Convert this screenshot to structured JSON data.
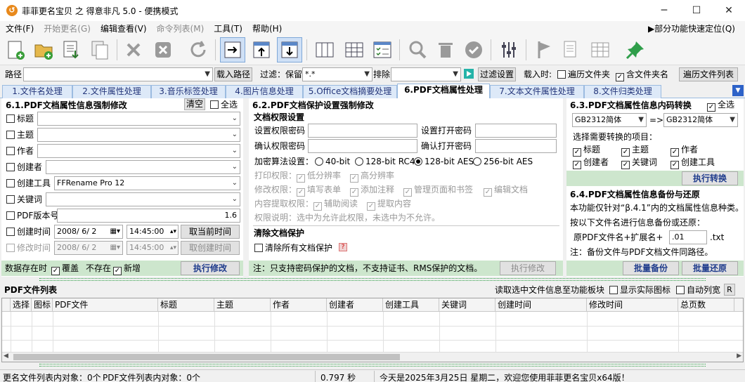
{
  "window": {
    "title": "菲菲更名宝贝 之 得意非凡 5.0 - 便携模式",
    "icon_glyph": "↺",
    "minimize": "─",
    "maximize": "☐",
    "close": "✕"
  },
  "menu": {
    "items": [
      "文件(F)",
      "开始更名(G)",
      "编辑查看(V)",
      "命令列表(M)",
      "工具(T)",
      "帮助(H)"
    ],
    "quick": "▶部分功能快速定位(Q)"
  },
  "toolbar": {
    "icons": [
      "new-file-icon",
      "open-folder-icon",
      "import-icon",
      "copy-doc-icon",
      "delete-icon",
      "clear-icon",
      "refresh-icon",
      "export-right-icon",
      "export-up-icon",
      "export-down-icon",
      "columns-icon",
      "grid-icon",
      "checklist-icon",
      "search-icon",
      "trash-icon",
      "check-icon",
      "sliders-icon",
      "flag-icon",
      "table-icon",
      "pin-icon"
    ]
  },
  "pathbar": {
    "path_label": "路径",
    "path_value": "",
    "load_btn": "载入路径",
    "filter_label": "过滤：保留",
    "filter_value": "*.*",
    "exclude_label": "排除",
    "exclude_value": "",
    "filter_btn": "过滤设置",
    "load_when": "载入时:",
    "opt_subfolders": "遍历文件夹",
    "opt_folder_names": "含文件夹名",
    "list_btn": "遍历文件列表"
  },
  "tabs": [
    "1.文件名处理",
    "2.文件属性处理",
    "3.音乐标签处理",
    "4.图片信息处理",
    "5.Office文档摘要处理",
    "6.PDF文档属性处理",
    "7.文本文件属性处理",
    "8.文件归类处理"
  ],
  "left": {
    "title": "6.1.PDF文档属性信息强制修改",
    "clear_btn": "清空",
    "select_all": "全选",
    "fields": [
      {
        "label": "标题",
        "value": ""
      },
      {
        "label": "主题",
        "value": ""
      },
      {
        "label": "作者",
        "value": ""
      },
      {
        "label": "创建者",
        "value": ""
      },
      {
        "label": "创建工具",
        "value": "FFRename Pro 12"
      },
      {
        "label": "关键词",
        "value": ""
      }
    ],
    "version_label": "PDF版本号",
    "version_value": "1.6",
    "ctime_label": "创建时间",
    "ctime_date": "2008/ 6/ 2",
    "ctime_time": "14:45:00",
    "ctime_btn": "取当前时间",
    "mtime_label": "修改时间",
    "mtime_date": "2008/ 6/ 2",
    "mtime_time": "14:45:00",
    "mtime_btn": "取创建时间",
    "exists_label": "数据存在时",
    "overwrite": "覆盖",
    "not_exists": "不存在",
    "add_new": "新增",
    "exec_btn": "执行修改"
  },
  "mid": {
    "title": "6.2.PDF文档保护设置强制修改",
    "perm_title": "文档权限设置",
    "set_perm_pwd": "设置权限密码",
    "set_open_pwd": "设置打开密码",
    "confirm_perm_pwd": "确认权限密码",
    "confirm_open_pwd": "确认打开密码",
    "enc_label": "加密算法设置：",
    "enc_opts": [
      "40-bit",
      "128-bit RC4",
      "128-bit AES",
      "256-bit AES"
    ],
    "print_label": "打印权限：",
    "print_low": "低分辨率",
    "print_high": "高分辨率",
    "modify_label": "修改权限：",
    "mod_fill": "填写表单",
    "mod_comment": "添加注释",
    "mod_pages": "管理页面和书签",
    "mod_edit": "编辑文档",
    "extract_label": "内容提取权限：",
    "ext_assist": "辅助阅读",
    "ext_content": "提取内容",
    "perm_note": "权限说明：选中为允许此权限，未选中为不允许。",
    "clear_title": "清除文档保护",
    "clear_all": "清除所有文档保护",
    "help_glyph": "?",
    "note": "注：只支持密码保护的文档，不支持证书、RMS保护的文档。",
    "exec_btn": "执行修改"
  },
  "right": {
    "title": "6.3.PDF文档属性信息内码转换",
    "select_all": "全选",
    "from_enc": "GB2312简体",
    "arrow": "=>",
    "to_enc": "GB2312简体",
    "choose_label": "选择需要转换的项目：",
    "items": [
      "标题",
      "主题",
      "作者",
      "创建者",
      "关键词",
      "创建工具"
    ],
    "convert_btn": "执行转换",
    "backup_title": "6.4.PDF文档属性信息备份与还原",
    "backup_desc": "本功能仅针对“β.4.1”内的文档属性信息种类。",
    "backup_desc2": "按以下文件名进行信息备份或还原：",
    "name_prefix": "原PDF文件名+扩展名+",
    "name_ext_value": ".01",
    "name_suffix": ".txt",
    "backup_note": "注：备份文件与PDF文档文件同路径。",
    "backup_btn": "批量备份",
    "restore_btn": "批量还原"
  },
  "pdflist": {
    "title": "PDF文件列表",
    "read_info": "读取选中文件信息至功能板块",
    "show_icon": "显示实际图标",
    "auto_width": "自动列宽",
    "r_btn": "R",
    "columns": [
      "选择",
      "图标",
      "PDF文件",
      "标题",
      "主题",
      "作者",
      "创建者",
      "创建工具",
      "关键词",
      "创建时间",
      "修改时间",
      "总页数"
    ]
  },
  "status": {
    "rename_objs": "更名文件列表内对象：0个",
    "pdf_objs": "PDF文件列表内对象：0个",
    "time": "0.797 秒",
    "welcome": "今天是2025年3月25日 星期二，欢迎您使用菲菲更名宝贝x64版！"
  }
}
